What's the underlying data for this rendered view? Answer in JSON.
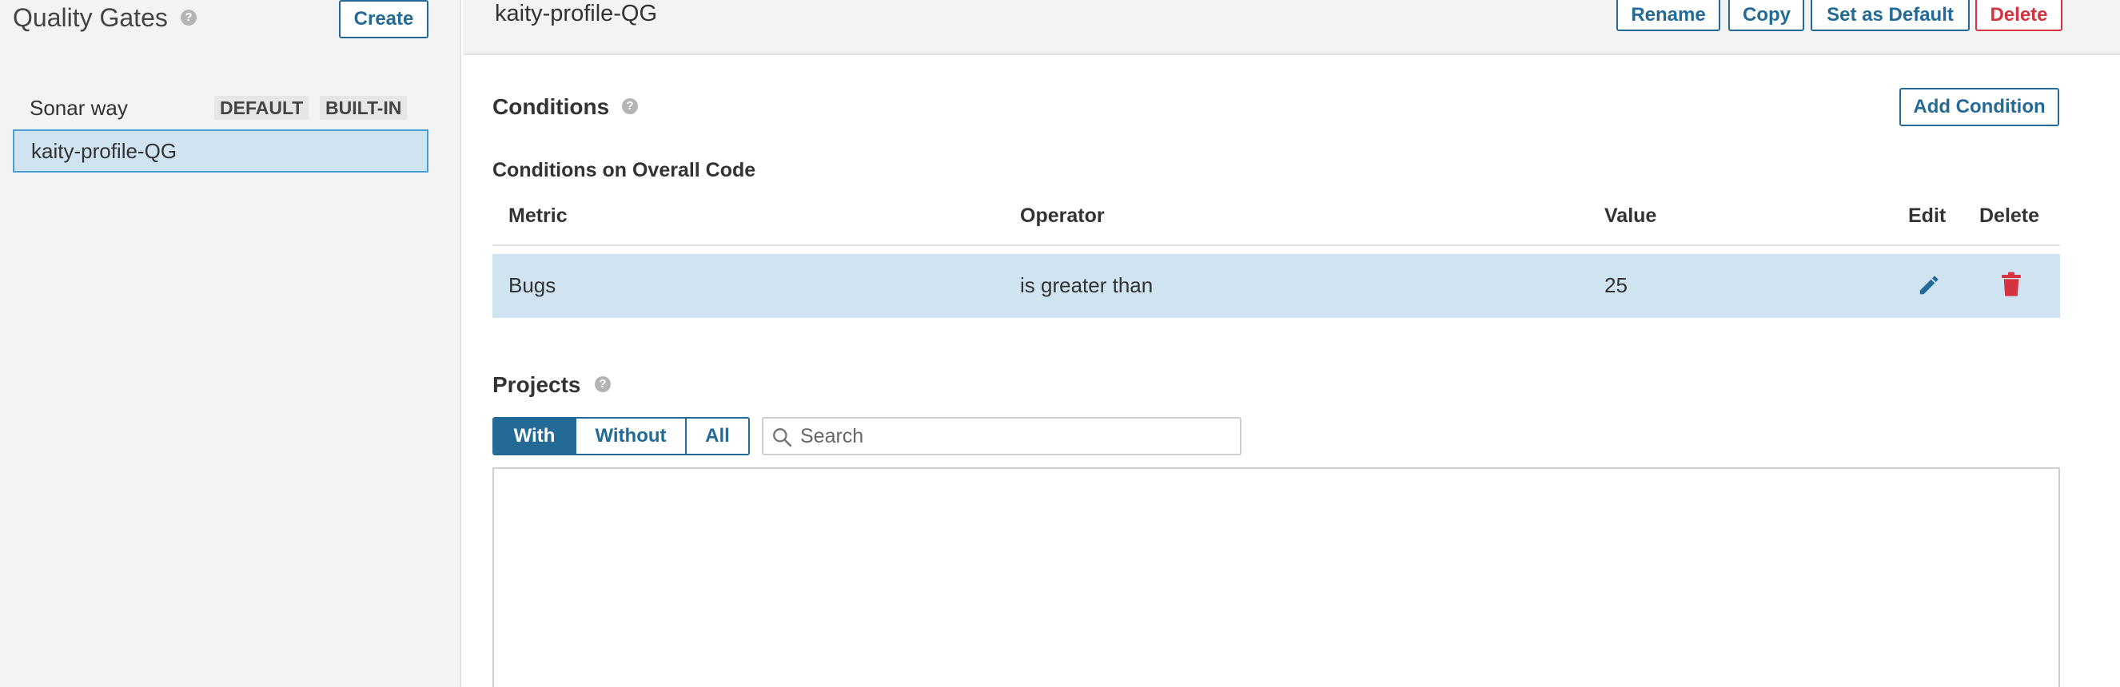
{
  "sidebar": {
    "title": "Quality Gates",
    "create_label": "Create",
    "gates": [
      {
        "name": "Sonar way",
        "badges": [
          "DEFAULT",
          "BUILT-IN"
        ]
      },
      {
        "name": "kaity-profile-QG",
        "selected": true
      }
    ]
  },
  "header": {
    "title": "kaity-profile-QG",
    "rename_label": "Rename",
    "copy_label": "Copy",
    "set_default_label": "Set as Default",
    "delete_label": "Delete"
  },
  "conditions": {
    "title": "Conditions",
    "add_label": "Add Condition",
    "subtitle": "Conditions on Overall Code",
    "columns": {
      "metric": "Metric",
      "operator": "Operator",
      "value": "Value",
      "edit": "Edit",
      "delete": "Delete"
    },
    "rows": [
      {
        "metric": "Bugs",
        "operator": "is greater than",
        "value": "25"
      }
    ]
  },
  "projects": {
    "title": "Projects",
    "filters": [
      "With",
      "Without",
      "All"
    ],
    "active_filter": "With",
    "search_placeholder": "Search"
  },
  "colors": {
    "accent": "#236a97",
    "danger": "#d4333f",
    "selected_bg": "#cfe3f0",
    "sidebar_bg": "#f3f3f3"
  },
  "icons": [
    "help-icon",
    "edit-icon",
    "trash-icon",
    "search-icon"
  ]
}
